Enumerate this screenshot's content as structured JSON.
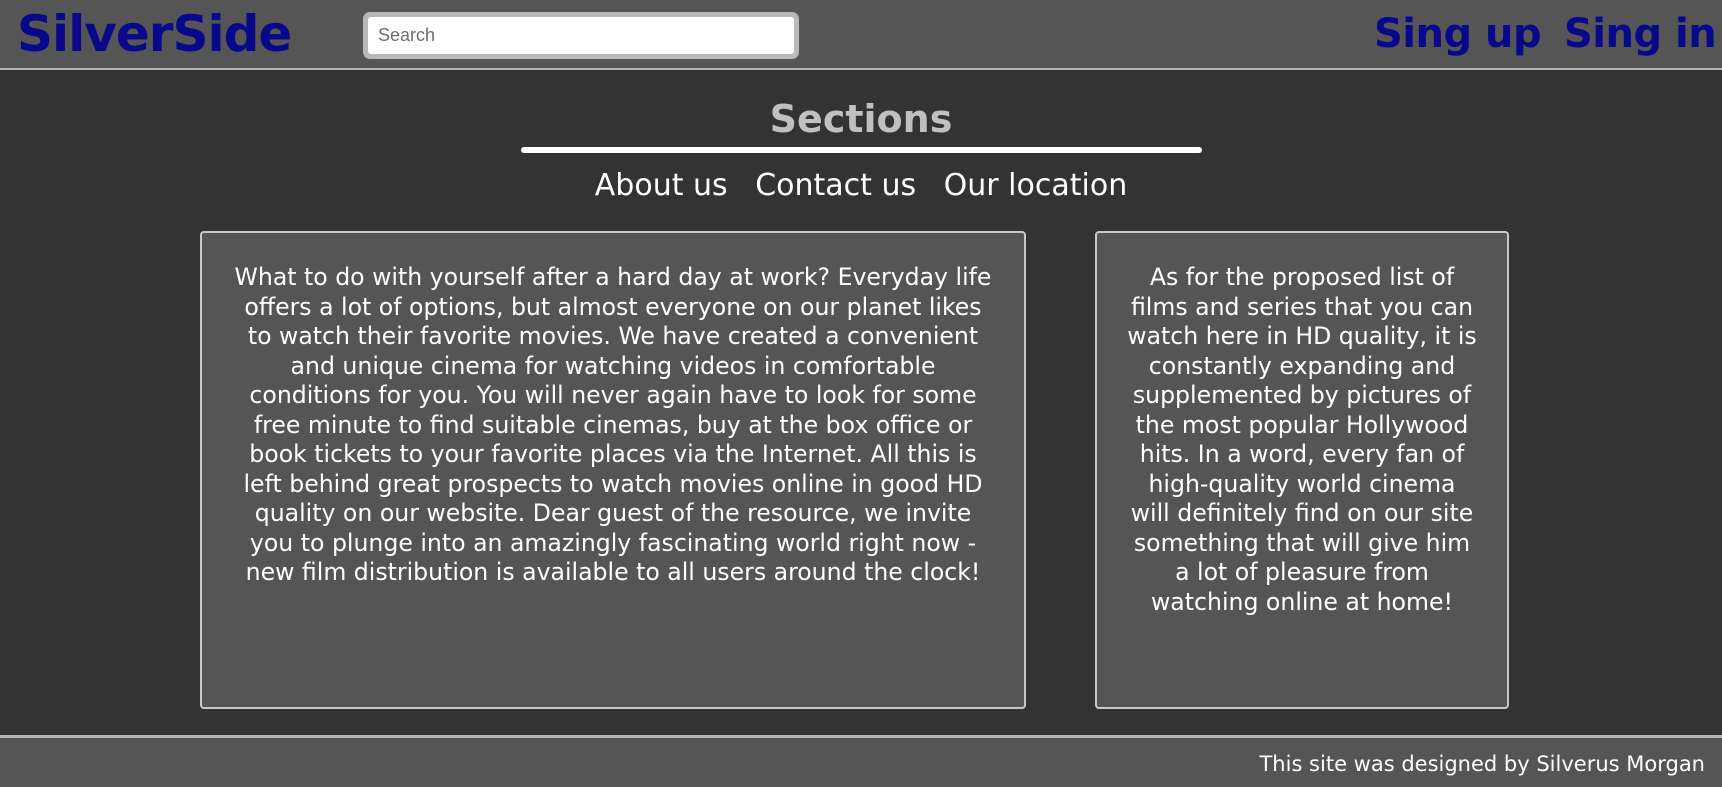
{
  "header": {
    "logo": "SilverSide",
    "search_placeholder": "Search",
    "search_value": "",
    "signup_label": "Sing up",
    "signin_label": "Sing in",
    "logo_color": "#08088a"
  },
  "sections": {
    "title": "Sections",
    "nav": [
      {
        "label": "About us"
      },
      {
        "label": "Contact us"
      },
      {
        "label": "Our location"
      }
    ]
  },
  "panels": {
    "left_text": "What to do with yourself after a hard day at work? Everyday life offers a lot of options, but almost everyone on our planet likes to watch their favorite movies. We have created a convenient and unique cinema for watching videos in comfortable conditions for you. You will never again have to look for some free minute to find suitable cinemas, buy at the box office or book tickets to your favorite places via the Internet. All this is left behind great prospects to watch movies online in good HD quality on our website. Dear guest of the resource, we invite you to plunge into an amazingly fascinating world right now - new film distribution is available to all users around the clock!",
    "right_text": "As for the proposed list of films and series that you can watch here in HD quality, it is constantly expanding and supplemented by pictures of the most popular Hollywood hits. In a word, every fan of high-quality world cinema will definitely find on our site something that will give him a lot of pleasure from watching online at home!"
  },
  "footer": {
    "credit": "This site was designed by Silverus Morgan"
  }
}
